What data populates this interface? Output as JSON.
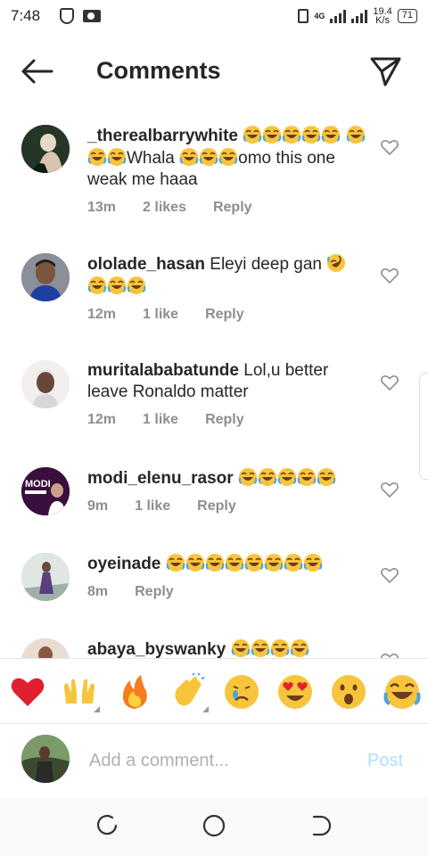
{
  "status": {
    "time": "7:48",
    "network": "4G",
    "speed": "19.4",
    "speed_unit": "K/s",
    "battery": "71"
  },
  "header": {
    "title": "Comments",
    "back_icon": "arrow-left-icon",
    "send_icon": "paper-plane-icon"
  },
  "comments": [
    {
      "username": "_therealbarrywhite",
      "text_before": "",
      "text_after": "Whala ",
      "text_end": "omo this one weak me haaa",
      "time": "13m",
      "likes": "2 likes",
      "reply": "Reply",
      "avatar_color": "#2f3b2d"
    },
    {
      "username": "ololade_hasan",
      "text": "Eleyi deep gan ",
      "time": "12m",
      "likes": "1 like",
      "reply": "Reply",
      "avatar_color": "#6b6f7a"
    },
    {
      "username": "muritalababatunde",
      "text": "Lol,u better leave Ronaldo matter",
      "time": "12m",
      "likes": "1 like",
      "reply": "Reply",
      "avatar_color": "#e8e4e2"
    },
    {
      "username": "modi_elenu_rasor",
      "text": "",
      "time": "9m",
      "likes": "1 like",
      "reply": "Reply",
      "avatar_color": "#3b0f3d",
      "avatar_text": "MODI"
    },
    {
      "username": "oyeinade",
      "text": "",
      "time": "8m",
      "likes": "",
      "reply": "Reply",
      "avatar_color": "#b9c8c4"
    },
    {
      "username": "abaya_byswanky",
      "text": "",
      "time": "",
      "likes": "",
      "reply": "",
      "avatar_color": "#c4a38c"
    }
  ],
  "reactions": [
    {
      "name": "red-heart",
      "glyph": "❤"
    },
    {
      "name": "raising-hands",
      "glyph": "🙌"
    },
    {
      "name": "fire",
      "glyph": "🔥"
    },
    {
      "name": "clapping-hands",
      "glyph": "👏"
    },
    {
      "name": "crying-face",
      "glyph": "😢"
    },
    {
      "name": "heart-eyes",
      "glyph": "😍"
    },
    {
      "name": "surprised-face",
      "glyph": "😮"
    },
    {
      "name": "tears-of-joy",
      "glyph": "😂"
    }
  ],
  "composer": {
    "placeholder": "Add a comment...",
    "post_label": "Post",
    "post_color": "#b3dbff"
  },
  "colors": {
    "meta_gray": "#8e8e8e",
    "text": "#262626",
    "emoji_yellow": "#f7c53b",
    "emoji_blue": "#4aa3df"
  }
}
